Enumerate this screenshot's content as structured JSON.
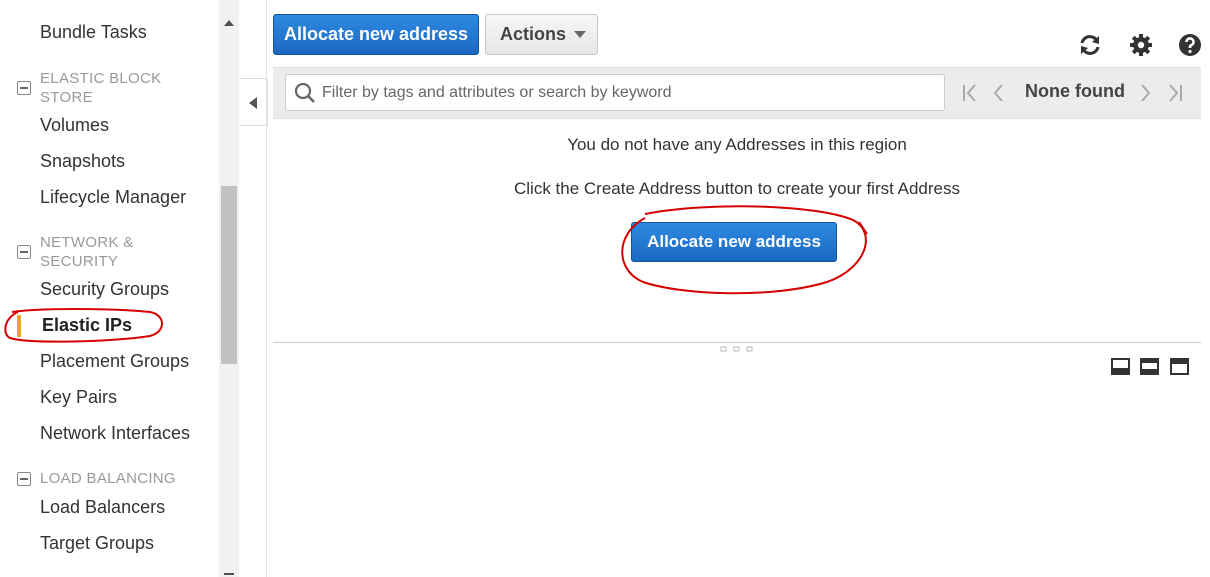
{
  "sidebar": {
    "bundle_tasks": "Bundle Tasks",
    "ebs": {
      "heading_line1": "ELASTIC BLOCK",
      "heading_line2": "STORE",
      "volumes": "Volumes",
      "snapshots": "Snapshots",
      "lifecycle": "Lifecycle Manager"
    },
    "network": {
      "heading_line1": "NETWORK &",
      "heading_line2": "SECURITY",
      "security_groups": "Security Groups",
      "elastic_ips": "Elastic IPs",
      "placement_groups": "Placement Groups",
      "key_pairs": "Key Pairs",
      "network_interfaces": "Network Interfaces"
    },
    "lb": {
      "heading": "LOAD BALANCING",
      "load_balancers": "Load Balancers",
      "target_groups": "Target Groups"
    }
  },
  "toolbar": {
    "allocate_label": "Allocate new address",
    "actions_label": "Actions",
    "icons": [
      "refresh-icon",
      "gear-icon",
      "help-icon"
    ]
  },
  "filter": {
    "placeholder": "Filter by tags and attributes or search by keyword",
    "pager_status": "None found"
  },
  "empty_state": {
    "line1": "You do not have any Addresses in this region",
    "line2": "Click the Create Address button to create your first Address",
    "button_label": "Allocate new address"
  },
  "colors": {
    "primary": "#1a68c0",
    "active_indicator": "#f0a030",
    "annotation": "#d40000"
  }
}
